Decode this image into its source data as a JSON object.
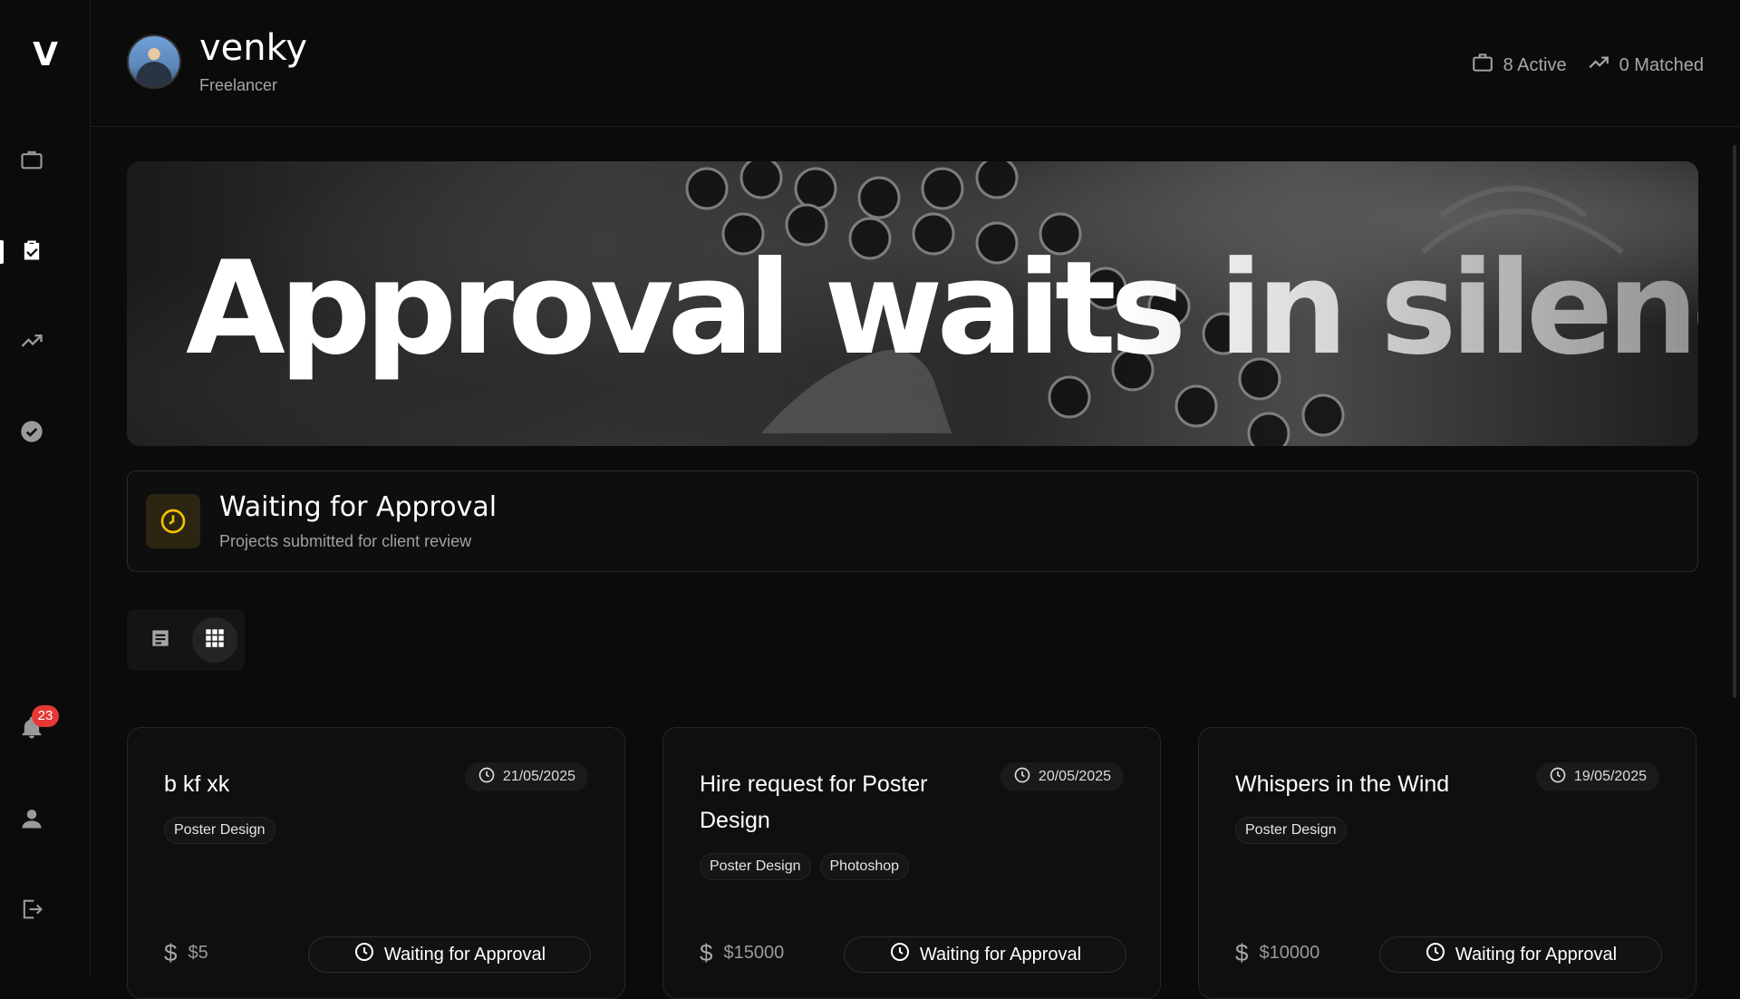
{
  "sidebar": {
    "logo": "V",
    "items": [
      {
        "name": "briefcase-icon"
      },
      {
        "name": "clipboard-check-icon",
        "active": true
      },
      {
        "name": "trending-up-icon"
      },
      {
        "name": "check-circle-icon"
      }
    ],
    "notification_count": "23"
  },
  "header": {
    "user_name": "venky",
    "user_role": "Freelancer",
    "active_label": "8 Active",
    "matched_label": "0 Matched"
  },
  "hero": {
    "headline": "Approval waits in silence."
  },
  "section": {
    "title": "Waiting for Approval",
    "subtitle": "Projects submitted for client review",
    "accent_color": "#f2c200"
  },
  "cards": [
    {
      "title": "b kf xk",
      "date": "21/05/2025",
      "tags": [
        "Poster Design"
      ],
      "price": "$5",
      "status": "Waiting for Approval"
    },
    {
      "title": "Hire request for Poster Design",
      "date": "20/05/2025",
      "tags": [
        "Poster Design",
        "Photoshop"
      ],
      "price": "$15000",
      "status": "Waiting for Approval"
    },
    {
      "title": "Whispers in the Wind",
      "date": "19/05/2025",
      "tags": [
        "Poster Design"
      ],
      "price": "$10000",
      "status": "Waiting for Approval"
    }
  ]
}
